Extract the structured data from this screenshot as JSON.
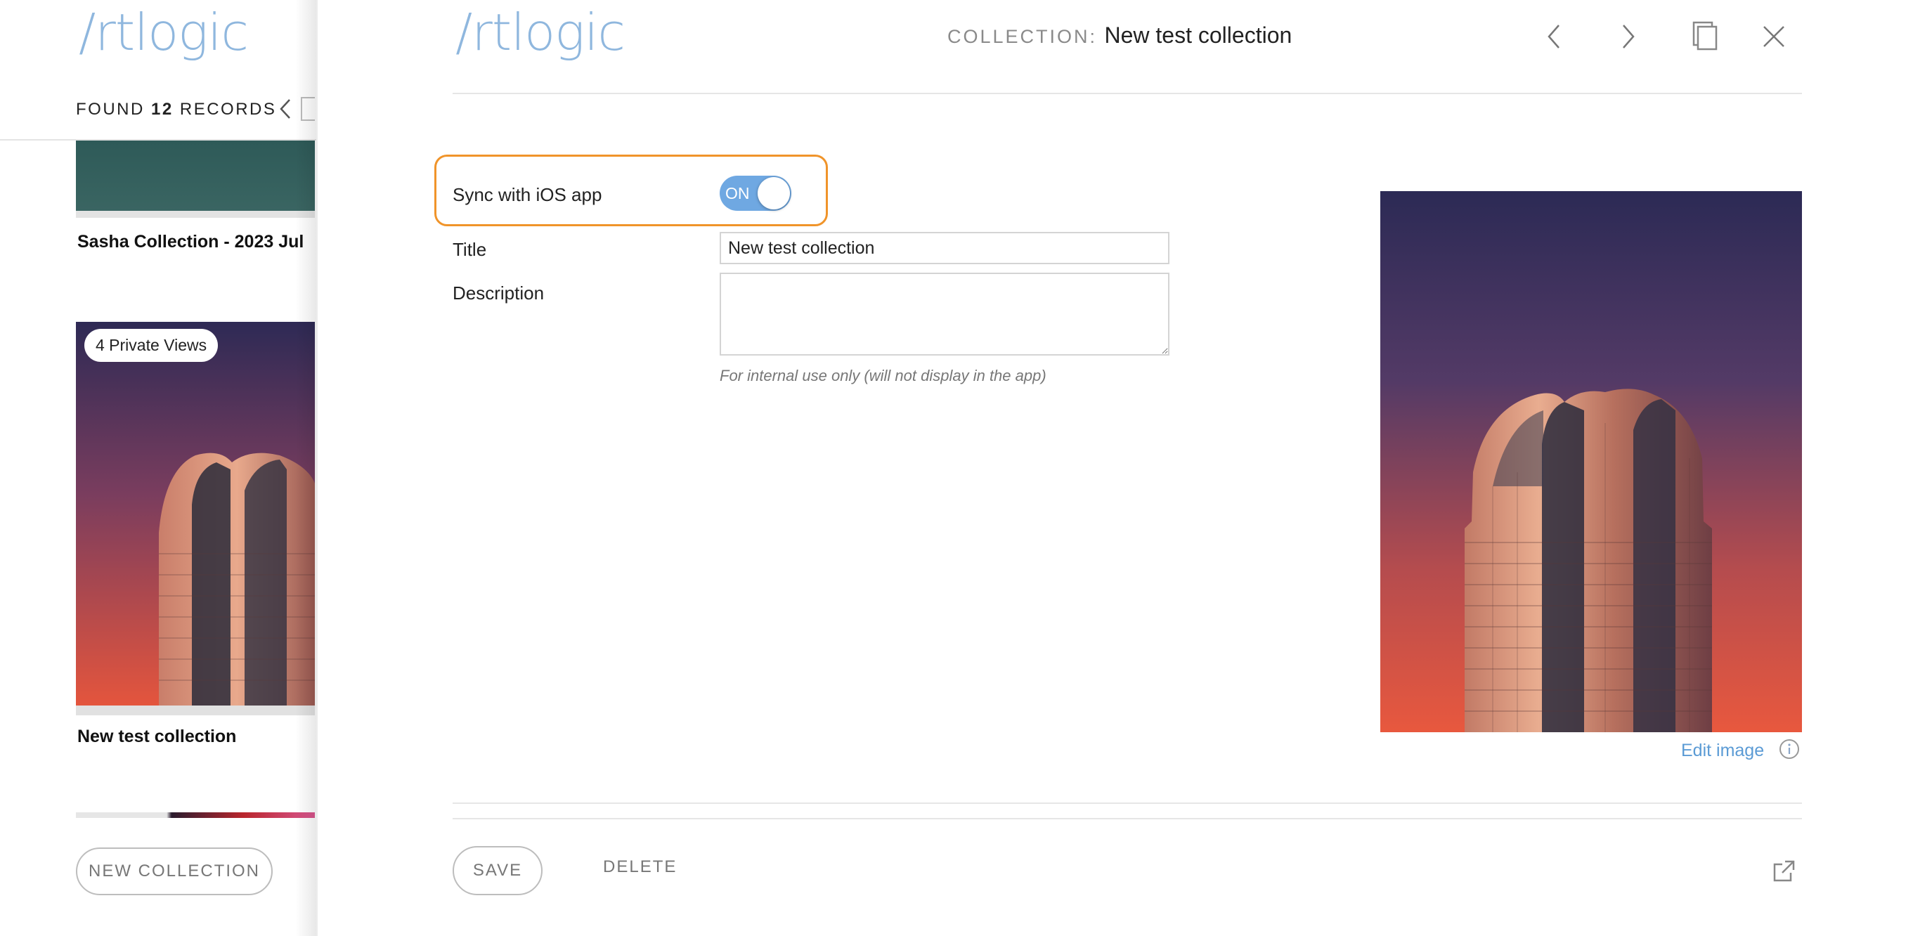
{
  "app": {
    "logo_text": "/rtlogic"
  },
  "background_list": {
    "found_prefix": "FOUND",
    "found_count": "12",
    "found_suffix": "RECORDS",
    "cards": [
      {
        "title": "Sasha Collection - 2023 Jul"
      },
      {
        "title": "New test collection",
        "badge": "4 Private Views"
      }
    ],
    "new_collection_label": "NEW COLLECTION"
  },
  "modal": {
    "heading_label": "COLLECTION:",
    "heading_value": "New test collection",
    "nav_icons": [
      "chevron-left-icon",
      "chevron-right-icon",
      "duplicate-icon",
      "close-icon"
    ],
    "sync": {
      "label": "Sync with iOS app",
      "toggle_text": "ON",
      "enabled": true,
      "highlight_color": "#f0942a"
    },
    "title_field": {
      "label": "Title",
      "value": "New test collection"
    },
    "description_field": {
      "label": "Description",
      "value": "",
      "help_text": "For internal use only (will not display in the app)"
    },
    "image": {
      "edit_label": "Edit image"
    },
    "footer": {
      "save_label": "SAVE",
      "delete_label": "DELETE"
    }
  },
  "colors": {
    "accent_blue": "#6fa8e2",
    "link_blue": "#5b9bd5",
    "logo_blue": "#8fb7de",
    "highlight_orange": "#f0942a"
  }
}
